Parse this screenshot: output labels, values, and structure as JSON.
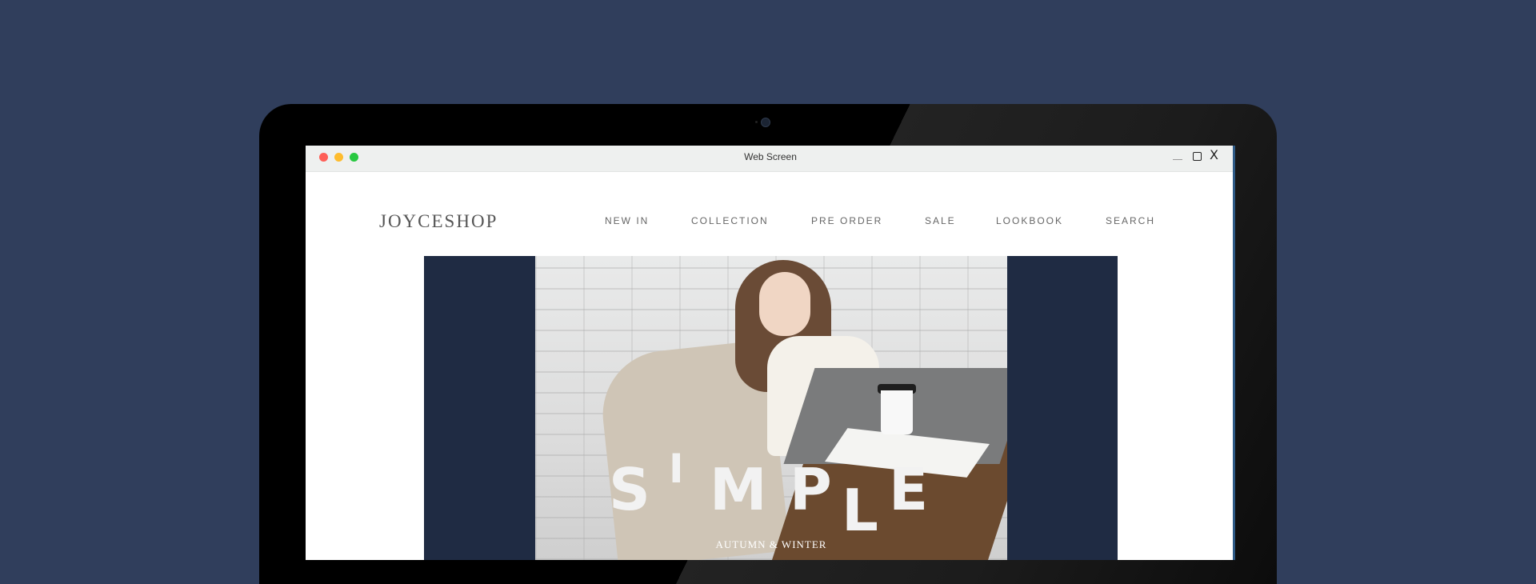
{
  "window": {
    "title": "Web Screen",
    "controls": {
      "close_label": "X"
    }
  },
  "site": {
    "logo": "JOYCESHOP",
    "nav": [
      "NEW IN",
      "COLLECTION",
      "PRE ORDER",
      "SALE",
      "LOOKBOOK",
      "SEARCH"
    ]
  },
  "hero": {
    "headline_letters": [
      "S",
      "I",
      "M",
      "P",
      "L",
      "E"
    ],
    "subtitle": "AUTUMN & WINTER"
  },
  "colors": {
    "background": "#303e5c",
    "hero_panel": "#1f2b43",
    "traffic_red": "#fe5f57",
    "traffic_yellow": "#febc2e",
    "traffic_green": "#28c840"
  }
}
